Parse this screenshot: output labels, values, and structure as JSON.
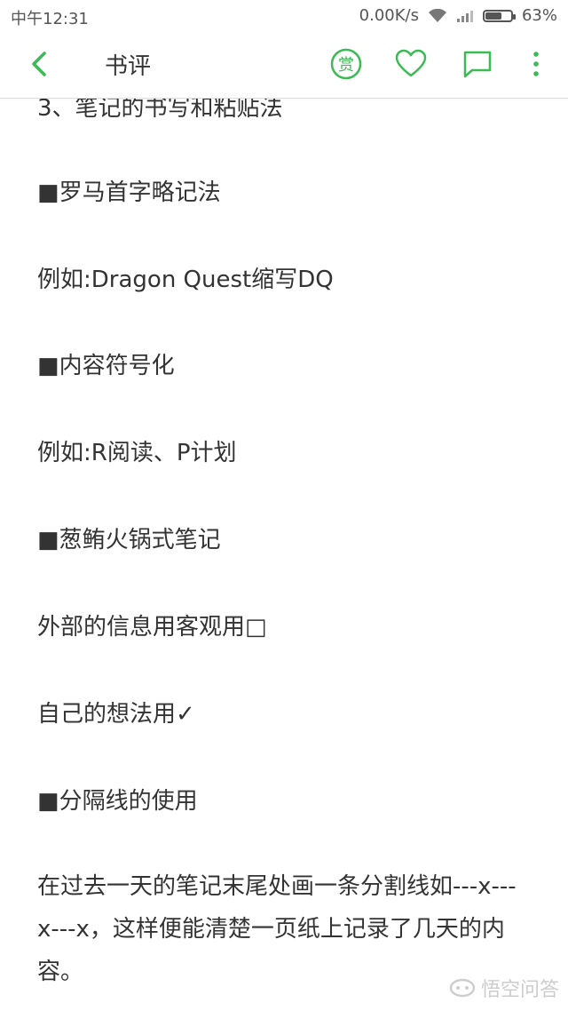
{
  "status_bar": {
    "time": "中午12:31",
    "net_speed": "0.00K/s",
    "battery": "63%",
    "battery_level": 0.63
  },
  "toolbar": {
    "title": "书评",
    "reward_label": "赏"
  },
  "content": {
    "paragraphs": [
      "3、笔记的书写和粘贴法",
      "■罗马首字略记法",
      "例如:Dragon Quest缩写DQ",
      "■内容符号化",
      "例如:R阅读、P计划",
      "■葱鲔火锅式笔记",
      "外部的信息用客观用□",
      "自己的想法用✓",
      "■分隔线的使用",
      "在过去一天的笔记末尾处画一条分割线如---x---x---x，这样便能清楚一页纸上记录了几天的内容。"
    ]
  },
  "watermark": {
    "text": "悟空问答"
  },
  "colors": {
    "accent": "#3cba54",
    "text": "#333333"
  }
}
